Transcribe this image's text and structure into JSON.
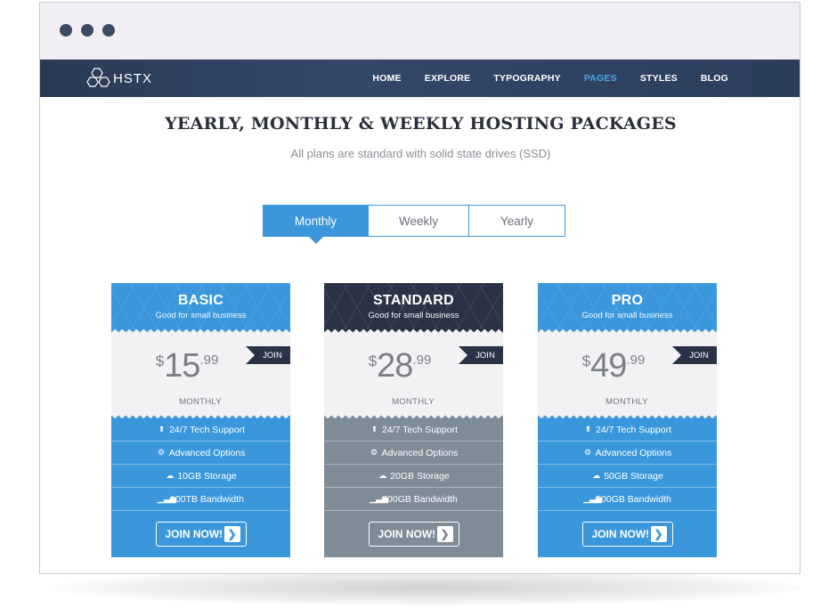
{
  "window": {
    "controls": [
      "window-dot-1",
      "window-dot-2",
      "window-dot-3"
    ]
  },
  "nav": {
    "logo_text": "HSTX",
    "items": [
      {
        "label": "HOME",
        "active": false
      },
      {
        "label": "EXPLORE",
        "active": false
      },
      {
        "label": "TYPOGRAPHY",
        "active": false
      },
      {
        "label": "PAGES",
        "active": true
      },
      {
        "label": "STYLES",
        "active": false
      },
      {
        "label": "BLOG",
        "active": false
      }
    ]
  },
  "header": {
    "title": "YEARLY, MONTHLY & WEEKLY HOSTING PACKAGES",
    "subtitle": "All plans are standard with solid state drives (SSD)"
  },
  "tabs": [
    {
      "label": "Monthly",
      "active": true
    },
    {
      "label": "Weekly",
      "active": false
    },
    {
      "label": "Yearly",
      "active": false
    }
  ],
  "plans": [
    {
      "name": "BASIC",
      "tagline": "Good for small business",
      "currency": "$",
      "amount": "15",
      "cents": ".99",
      "period": "MONTHLY",
      "join_tag": "JOIN",
      "features": [
        "24/7 Tech Support",
        "Advanced Options",
        "10GB Storage",
        "100TB Bandwidth"
      ],
      "button": "JOIN NOW!",
      "head_color": "#3a97dc",
      "body_color": "#3a97dc"
    },
    {
      "name": "STANDARD",
      "tagline": "Good for small business",
      "currency": "$",
      "amount": "28",
      "cents": ".99",
      "period": "MONTHLY",
      "join_tag": "JOIN",
      "features": [
        "24/7 Tech Support",
        "Advanced Options",
        "20GB Storage",
        "200GB Bandwidth"
      ],
      "button": "JOIN NOW!",
      "head_color": "#2a3346",
      "body_color": "#7e8c98"
    },
    {
      "name": "PRO",
      "tagline": "Good for small business",
      "currency": "$",
      "amount": "49",
      "cents": ".99",
      "period": "MONTHLY",
      "join_tag": "JOIN",
      "features": [
        "24/7 Tech Support",
        "Advanced Options",
        "50GB Storage",
        "500GB Bandwidth"
      ],
      "button": "JOIN NOW!",
      "head_color": "#3a97dc",
      "body_color": "#3a97dc"
    }
  ],
  "feature_icons": [
    "user-upload-icon",
    "gears-icon",
    "cloud-icon",
    "signal-bars-icon"
  ]
}
